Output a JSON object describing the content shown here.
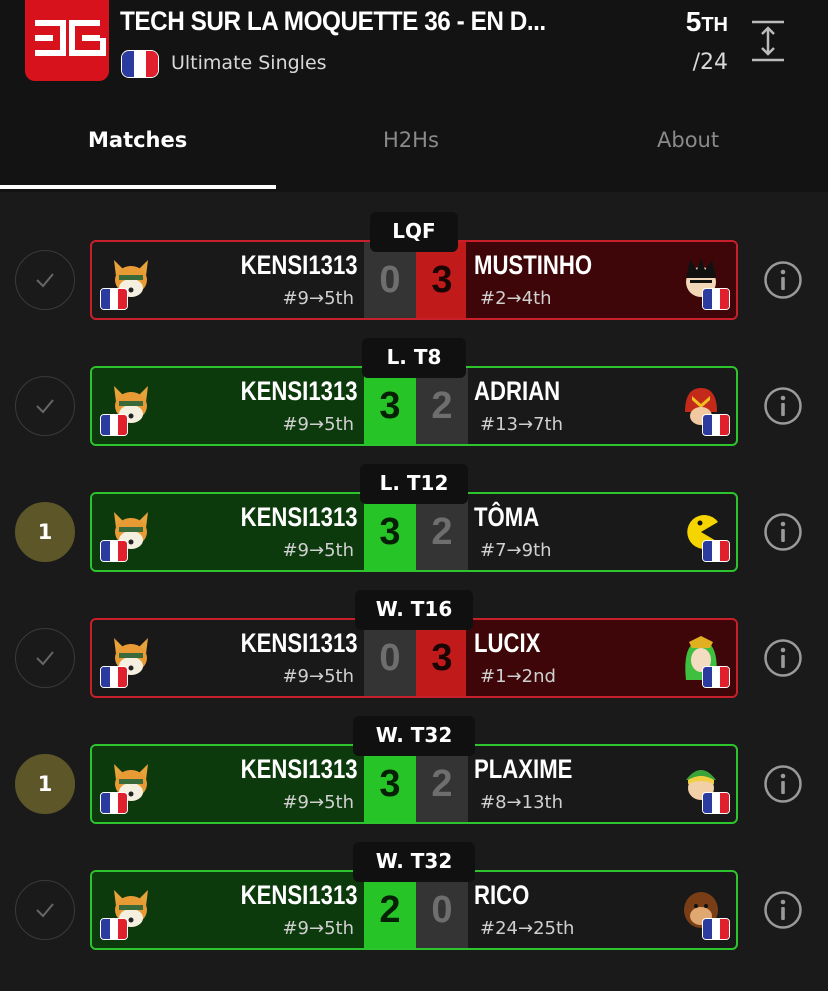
{
  "header": {
    "title": "TECH SUR LA MOQUETTE 36 - EN D...",
    "event": "Ultimate Singles",
    "place_num": "5",
    "place_suffix": "TH",
    "total": "/24"
  },
  "tabs": [
    "Matches",
    "H2Hs",
    "About"
  ],
  "colors": {
    "loss": "#c8202a",
    "win": "#2ec42e",
    "background": "#1a1a1a"
  },
  "matches": [
    {
      "round": "LQF",
      "status": "check-icon",
      "result": "loss",
      "player": {
        "name": "KENSI1313",
        "seed": "#9→5th",
        "score": "0",
        "character": "fox-icon"
      },
      "opponent": {
        "name": "MUSTINHO",
        "seed": "#2→4th",
        "score": "3",
        "character": "kazuya-icon"
      }
    },
    {
      "round": "L. T8",
      "status": "check-icon",
      "result": "win",
      "player": {
        "name": "KENSI1313",
        "seed": "#9→5th",
        "score": "3",
        "character": "fox-icon"
      },
      "opponent": {
        "name": "ADRIAN",
        "seed": "#13→7th",
        "score": "2",
        "character": "captain-falcon-icon"
      }
    },
    {
      "round": "L. T12",
      "status": "1",
      "result": "win",
      "player": {
        "name": "KENSI1313",
        "seed": "#9→5th",
        "score": "3",
        "character": "fox-icon"
      },
      "opponent": {
        "name": "TÔMA",
        "seed": "#7→9th",
        "score": "2",
        "character": "pac-man-icon"
      }
    },
    {
      "round": "W. T16",
      "status": "check-icon",
      "result": "loss",
      "player": {
        "name": "KENSI1313",
        "seed": "#9→5th",
        "score": "0",
        "character": "fox-icon"
      },
      "opponent": {
        "name": "LUCIX",
        "seed": "#1→2nd",
        "score": "3",
        "character": "palutena-icon"
      }
    },
    {
      "round": "W. T32",
      "status": "1",
      "result": "win",
      "player": {
        "name": "KENSI1313",
        "seed": "#9→5th",
        "score": "3",
        "character": "fox-icon"
      },
      "opponent": {
        "name": "PLAXIME",
        "seed": "#8→13th",
        "score": "2",
        "character": "young-link-icon"
      }
    },
    {
      "round": "W. T32",
      "status": "check-icon",
      "result": "win",
      "player": {
        "name": "KENSI1313",
        "seed": "#9→5th",
        "score": "2",
        "character": "fox-icon"
      },
      "opponent": {
        "name": "RICO",
        "seed": "#24→25th",
        "score": "0",
        "character": "donkey-kong-icon"
      }
    }
  ]
}
